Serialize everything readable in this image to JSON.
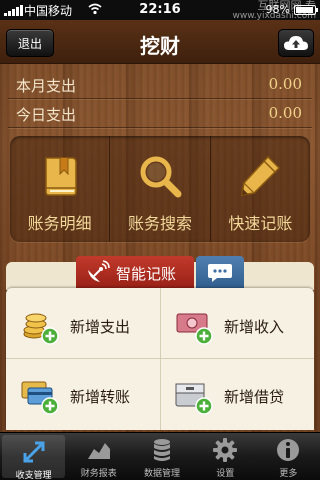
{
  "status_bar": {
    "carrier": "中国移动",
    "time": "22:16",
    "battery": "98%",
    "watermark_line1": "互联网网 专",
    "watermark_line2": "www.yixdashi.com"
  },
  "nav": {
    "title": "挖财",
    "back_label": "退出",
    "cloud_icon": "cloud-upload-icon"
  },
  "summary": {
    "month_label": "本月支出",
    "month_value": "0.00",
    "today_label": "今日支出",
    "today_value": "0.00"
  },
  "quick_actions": [
    {
      "label": "账务明细",
      "icon": "ledger-book-icon"
    },
    {
      "label": "账务搜索",
      "icon": "search-icon"
    },
    {
      "label": "快速记账",
      "icon": "pencil-icon"
    }
  ],
  "tabs": {
    "smart_label": "智能记账",
    "smart_icon": "satellite-dish-icon",
    "message_icon": "chat-bubble-icon"
  },
  "actions": [
    {
      "label": "新增支出",
      "icon": "coins-add-icon"
    },
    {
      "label": "新增收入",
      "icon": "cash-add-icon"
    },
    {
      "label": "新增转账",
      "icon": "cards-add-icon"
    },
    {
      "label": "新增借贷",
      "icon": "drawer-add-icon"
    }
  ],
  "tabbar": [
    {
      "label": "收支管理",
      "icon": "arrows-expand-icon",
      "active": true
    },
    {
      "label": "财务报表",
      "icon": "chart-icon",
      "active": false
    },
    {
      "label": "数据管理",
      "icon": "database-icon",
      "active": false
    },
    {
      "label": "设置",
      "icon": "gear-icon",
      "active": false
    },
    {
      "label": "更多",
      "icon": "info-icon",
      "active": false
    }
  ],
  "colors": {
    "wood": "#7a4a26",
    "tab_red": "#b12a1f",
    "tab_blue": "#3f6fa0",
    "card_bg": "#f6f1e3",
    "value_gold": "#f1d38a"
  }
}
